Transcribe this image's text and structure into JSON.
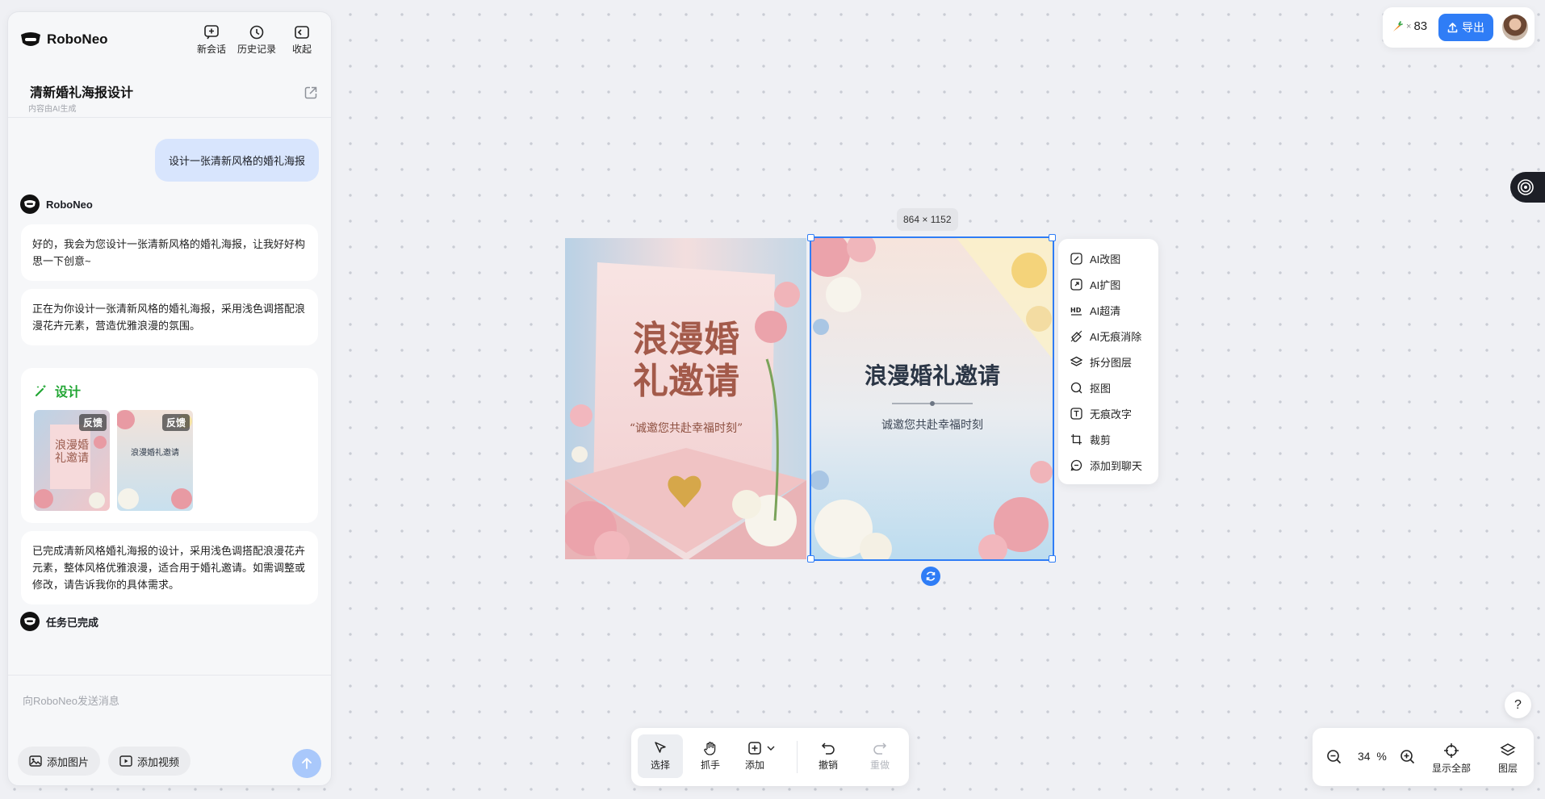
{
  "app": {
    "name": "RoboNeo"
  },
  "header": {
    "new_chat": "新会话",
    "history": "历史记录",
    "collapse": "收起"
  },
  "chat": {
    "title": "清新婚礼海报设计",
    "subtitle": "内容由AI生成",
    "user_message": "设计一张清新风格的婚礼海报",
    "agent_name": "RoboNeo",
    "reply1": "好的，我会为您设计一张清新风格的婚礼海报，让我好好构思一下创意~",
    "reply2": "正在为你设计一张清新风格的婚礼海报，采用浅色调搭配浪漫花卉元素，营造优雅浪漫的氛围。",
    "design_label": "设计",
    "thumb_badge": "反馈",
    "reply3": "已完成清新风格婚礼海报的设计，采用浅色调搭配浪漫花卉元素，整体风格优雅浪漫，适合用于婚礼邀请。如需调整或修改，请告诉我你的具体需求。",
    "task_done": "任务已完成",
    "input_placeholder": "向RoboNeo发送消息",
    "add_image": "添加图片",
    "add_video": "添加视频"
  },
  "topbar": {
    "credits": "83",
    "credits_multiplier": "×",
    "export": "导出"
  },
  "canvas": {
    "selection_size": "864 × 1152",
    "poster1": {
      "title_line1": "浪漫婚",
      "title_line2": "礼邀请",
      "tagline": "“诚邀您共赴幸福时刻”"
    },
    "poster2": {
      "title": "浪漫婚礼邀请",
      "tagline": "诚邀您共赴幸福时刻"
    }
  },
  "context_menu": [
    {
      "label": "AI改图",
      "icon": "ai-edit-icon"
    },
    {
      "label": "AI扩图",
      "icon": "ai-expand-icon"
    },
    {
      "label": "AI超清",
      "icon": "hd-icon"
    },
    {
      "label": "AI无痕消除",
      "icon": "eraser-icon"
    },
    {
      "label": "拆分图层",
      "icon": "layers-icon"
    },
    {
      "label": "抠图",
      "icon": "cutout-icon"
    },
    {
      "label": "无痕改字",
      "icon": "text-edit-icon"
    },
    {
      "label": "裁剪",
      "icon": "crop-icon"
    },
    {
      "label": "添加到聊天",
      "icon": "chat-add-icon"
    }
  ],
  "toolbar": {
    "select": "选择",
    "hand": "抓手",
    "add": "添加",
    "undo": "撤销",
    "redo": "重做"
  },
  "zoom": {
    "value": "34",
    "unit": "%",
    "fit_all": "显示全部",
    "layers": "图层"
  },
  "help": "?",
  "colors": {
    "accent": "#2f7df6",
    "design_green": "#22a634",
    "user_bubble": "#d8e5fd"
  }
}
